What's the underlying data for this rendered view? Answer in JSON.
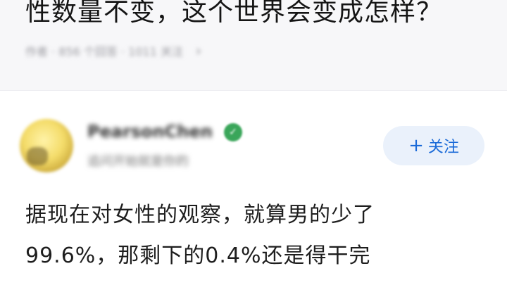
{
  "question": {
    "title": "性数量不变，这个世界会变成怎样？",
    "meta": [
      "作者 · 856 个回答 · 1011 关注"
    ]
  },
  "answer": {
    "author": {
      "name": "PearsonChen",
      "bio": "追问开始就是你的"
    },
    "follow_label": "关注",
    "follow_icon": "plus-icon",
    "text_lines": [
      "据现在对女性的观察，就算男的少了",
      "99.6%，那剩下的0.4%还是得干完"
    ]
  },
  "colors": {
    "accent": "#1a6ad8",
    "follow_bg": "#eaf1fb",
    "header_bg": "#f7f7f9",
    "verified": "#3aa65a"
  }
}
